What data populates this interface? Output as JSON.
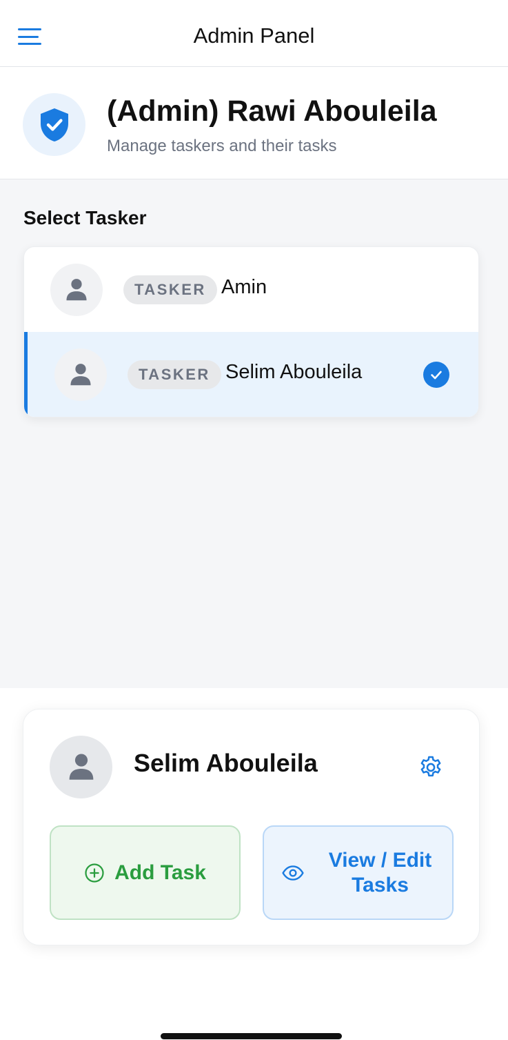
{
  "nav": {
    "title": "Admin Panel",
    "menu_icon": "hamburger-menu-icon"
  },
  "profile": {
    "name": "(Admin) Rawi Abouleila",
    "subtitle": "Manage taskers and their tasks",
    "icon": "shield-check-icon"
  },
  "tasker_section": {
    "label": "Select Tasker",
    "taskers": [
      {
        "badge": "TASKER",
        "name": "Amin",
        "selected": false
      },
      {
        "badge": "TASKER",
        "name": "Selim Abouleila",
        "selected": true
      }
    ]
  },
  "detail": {
    "name": "Selim Abouleila",
    "add_label": "Add Task",
    "view_label_line1": "View / Edit",
    "view_label_line2": "Tasks"
  },
  "colors": {
    "accent": "#1a7be0",
    "success": "#2a9d3f",
    "muted_text": "#6b7280"
  }
}
